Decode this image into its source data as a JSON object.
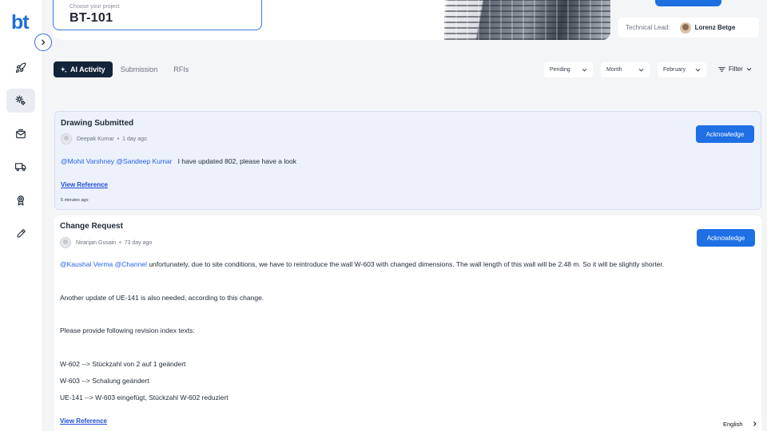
{
  "app": {
    "logo": "bt"
  },
  "sidebar": {
    "items": [
      {
        "icon": "rocket-icon",
        "active": false
      },
      {
        "icon": "settings-cog-icon",
        "active": true
      },
      {
        "icon": "inbox-mail-icon",
        "active": false
      },
      {
        "icon": "truck-icon",
        "active": false
      },
      {
        "icon": "award-badge-icon",
        "active": false
      },
      {
        "icon": "pencil-icon",
        "active": false
      }
    ]
  },
  "header": {
    "project_label": "Choose your project",
    "project_value": "BT-101",
    "lead_label": "Technical Lead:",
    "lead_name": "Lorenz Betge"
  },
  "tabs": [
    {
      "label": "AI Activity",
      "active": true
    },
    {
      "label": "Submission",
      "active": false
    },
    {
      "label": "RFIs",
      "active": false
    }
  ],
  "filters": {
    "status": "Pending",
    "period": "Month",
    "month": "February",
    "filter_label": "Filter"
  },
  "cards": [
    {
      "title": "Drawing Submitted",
      "author": "Deepak Kumar",
      "age": "1 day ago",
      "button": "Acknowledge",
      "mentions": "@Mohit Varshney @Sandeep Kumar",
      "message": "I have updated 802, please have a look",
      "link": "View Reference",
      "time": "5 minutes ago"
    },
    {
      "title": "Change Request",
      "author": "Niranjan Gusain",
      "age": "73 day ago",
      "button": "Acknowledge",
      "mentions": "@Kaushal Verma @Channel",
      "message": "unfortunately, due to site conditions, we have to reintroduce the wall W-603 with changed dimensions. The wall length of this wall will be 2.48 m. So it will be slightly shorter.",
      "lines": [
        "Another update of UE-141 is also needed, according to this change.",
        "Please provide following revision index texts:",
        "W-602 --> Stückzahl von 2 auf 1 geändert",
        "W-603 --> Schalung geändert",
        "UE-141 --> W-603 eingefügt, Stückzahl W-602 reduziert"
      ],
      "link": "View Reference"
    }
  ],
  "footer": {
    "language": "English"
  },
  "colors": {
    "primary": "#1f6fe5",
    "tab_active": "#12243a",
    "mention": "#2563eb"
  }
}
